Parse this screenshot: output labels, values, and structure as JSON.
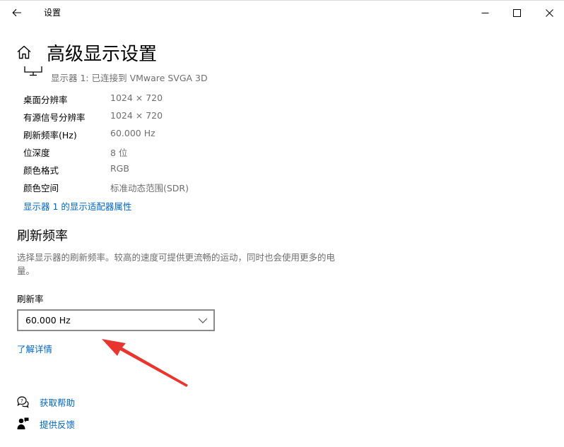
{
  "window": {
    "title": "设置"
  },
  "header": {
    "title": "高级显示设置"
  },
  "display": {
    "subtitle": "显示器 1: 已连接到 VMware SVGA 3D",
    "rows": [
      {
        "label": "桌面分辨率",
        "value": "1024 × 720"
      },
      {
        "label": "有源信号分辨率",
        "value": "1024 × 720"
      },
      {
        "label": "刷新频率(Hz)",
        "value": "60.000 Hz"
      },
      {
        "label": "位深度",
        "value": "8 位"
      },
      {
        "label": "颜色格式",
        "value": "RGB"
      },
      {
        "label": "颜色空间",
        "value": "标准动态范围(SDR)"
      }
    ],
    "adapter_link": "显示器 1 的显示适配器属性"
  },
  "refresh": {
    "section_title": "刷新频率",
    "description": "选择显示器的刷新频率。较高的速度可提供更流畅的运动，同时也会使用更多的电量。",
    "rate_label": "刷新率",
    "selected_rate": "60.000 Hz",
    "learn_more": "了解详情"
  },
  "help": {
    "get_help": "获取帮助",
    "feedback": "提供反馈"
  },
  "icons": {
    "back": "back-arrow-icon",
    "minimize": "minimize-icon",
    "maximize": "maximize-icon",
    "close": "close-icon",
    "home": "home-icon",
    "monitor": "monitor-icon",
    "chevron": "chevron-down-icon",
    "help": "help-chat-icon",
    "feedback": "feedback-person-icon",
    "annotation": "annotation-arrow-icon"
  },
  "colors": {
    "link": "#0067c0",
    "secondary_text": "#6e6e6e",
    "annotation": "#e8352e"
  }
}
